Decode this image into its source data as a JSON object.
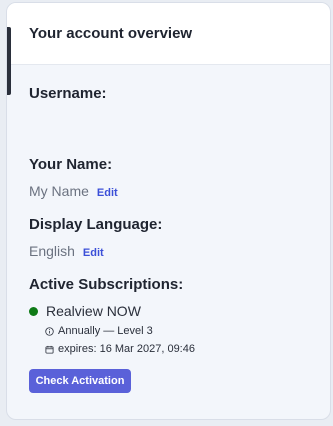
{
  "header": {
    "title": "Your account overview"
  },
  "username": {
    "label": "Username:",
    "value": ""
  },
  "name": {
    "label": "Your Name:",
    "value": "My Name",
    "edit_label": "Edit"
  },
  "language": {
    "label": "Display Language:",
    "value": "English",
    "edit_label": "Edit"
  },
  "subscriptions": {
    "label": "Active Subscriptions:",
    "items": [
      {
        "name": "Realview NOW",
        "status_color": "#0e7a16",
        "plan": "Annually — Level 3",
        "expires": "expires: 16 Mar 2027, 09:46"
      }
    ]
  },
  "actions": {
    "check_activation_label": "Check Activation"
  },
  "colors": {
    "accent": "#5a61d9",
    "link": "#3b4fd8",
    "active_status": "#0e7a16"
  },
  "icons": {
    "plan": "info-icon",
    "expires": "calendar-icon"
  }
}
